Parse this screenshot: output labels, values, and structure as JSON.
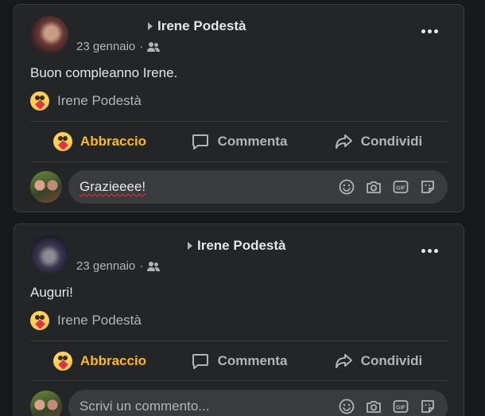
{
  "posts": [
    {
      "author": "Irene Podestà",
      "date": "23 gennaio",
      "meta_separator": "·",
      "text": "Buon compleanno Irene.",
      "reaction_name": "Irene Podestà",
      "actions": {
        "react": "Abbraccio",
        "comment": "Comment a",
        "share": "Condividi"
      },
      "comment_value": "Grazieeee!"
    },
    {
      "author": "Irene Podestà",
      "date": "23 gennaio",
      "meta_separator": "·",
      "text": "Auguri!",
      "reaction_name": "Irene Podestà",
      "actions": {
        "react": "Abbraccio",
        "comment": "Commenta",
        "share": "Condividi"
      },
      "comment_placeholder": "Scrivi un commento..."
    }
  ],
  "icons": [
    "friends-audience-icon",
    "more-options-icon",
    "hug-reaction-icon",
    "comment-icon",
    "share-icon",
    "emoji-icon",
    "camera-icon",
    "gif-icon",
    "sticker-icon"
  ],
  "colors": {
    "background": "#18191a",
    "card": "#242526",
    "text": "#e4e6eb",
    "muted": "#b0b3b8",
    "reaction_active": "#f7b928",
    "input_bg": "#3a3b3c"
  }
}
